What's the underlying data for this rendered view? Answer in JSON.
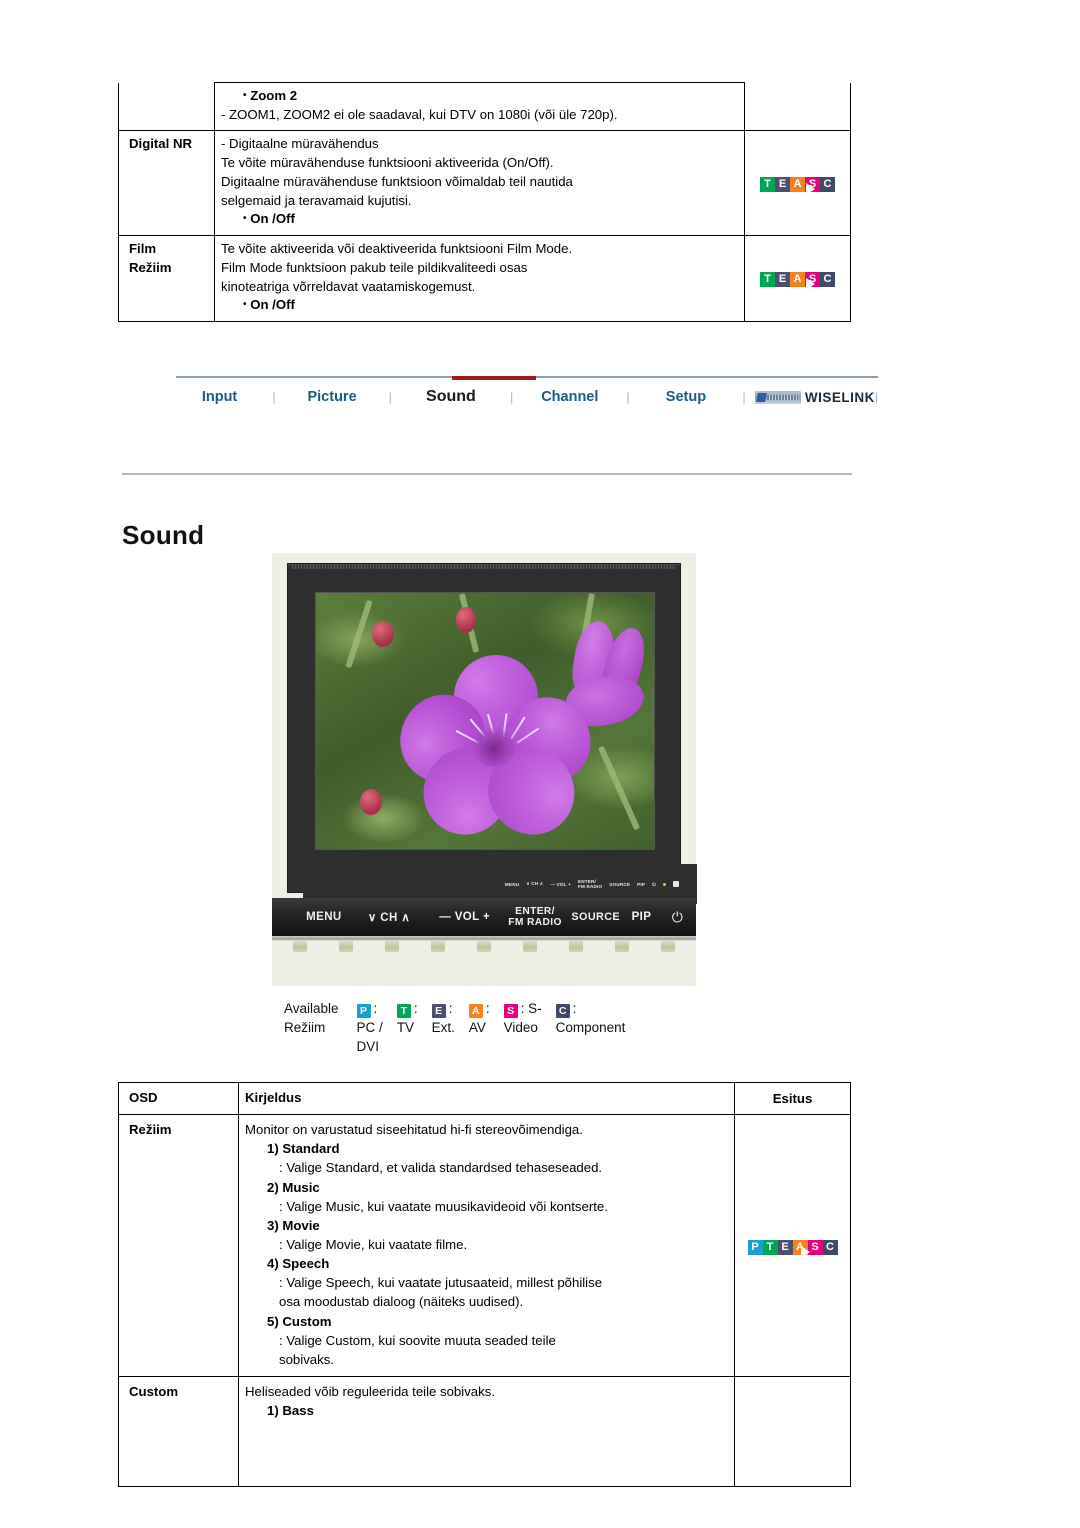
{
  "top_table": {
    "rows": [
      {
        "label": "",
        "bullet": "Zoom 2",
        "lines": [
          "- ZOOM1, ZOOM2 ei ole saadaval, kui DTV on 1080i (või üle 720p)."
        ],
        "footer": "",
        "icon": null
      },
      {
        "label": "Digital NR",
        "bullet": "",
        "lines": [
          "- Digitaalne müravähendus",
          "Te võite müravähenduse funktsiooni aktiveerida (On/Off).",
          "Digitaalne müravähenduse funktsioon võimaldab teil nautida",
          "selgemaid ja teravamaid kujutisi."
        ],
        "footer": "On /Off",
        "icon": {
          "name": "play-globe-icon",
          "badges": [
            "T",
            "E",
            "A",
            "S",
            "C"
          ]
        }
      },
      {
        "label_line1": "Film",
        "label_line2": "Režiim",
        "bullet": "",
        "lines": [
          "Te võite aktiveerida või deaktiveerida funktsiooni Film Mode.",
          "Film Mode funktsioon pakub teile pildikvaliteedi osas",
          "kinoteatriga võrreldavat vaatamiskogemust."
        ],
        "footer": "On /Off",
        "icon": {
          "name": "play-globe-icon",
          "badges": [
            "T",
            "E",
            "A",
            "S",
            "C"
          ]
        }
      }
    ]
  },
  "nav": {
    "tabs": [
      {
        "label": "Input",
        "active": false
      },
      {
        "label": "Picture",
        "active": false
      },
      {
        "label": "Sound",
        "active": true
      },
      {
        "label": "Channel",
        "active": false
      },
      {
        "label": "Setup",
        "active": false
      }
    ],
    "separator": "|",
    "wiselink_label": "WISELINK",
    "wiselink_logo": "wiselink-logo-icon",
    "active_color": "#9e1b1b",
    "tab_color": "#1d5c7c"
  },
  "page_title": "Sound",
  "monitor": {
    "screen_content": "purple tibouchina flower photo on green foliage",
    "control_buttons": {
      "menu": "MENU",
      "ch_down": "∨",
      "ch": "CH",
      "ch_up": "∧",
      "vol_minus": "—",
      "vol": "VOL",
      "vol_plus": "+",
      "enter_line1": "ENTER/",
      "enter_line2": "FM RADIO",
      "source": "SOURCE",
      "pip": "PIP",
      "power": "⏻"
    }
  },
  "available_modes": {
    "label_line1": "Available",
    "label_line2": "Režiim",
    "items": [
      {
        "badge": "P",
        "color": "#1a9ed4",
        "colon": ":",
        "name_line1": "PC /",
        "name_line2": "DVI"
      },
      {
        "badge": "T",
        "color": "#00a651",
        "colon": ":",
        "name_line1": "TV",
        "name_line2": ""
      },
      {
        "badge": "E",
        "color": "#4d4f6e",
        "colon": ":",
        "name_line1": "Ext.",
        "name_line2": ""
      },
      {
        "badge": "A",
        "color": "#f58220",
        "colon": ":",
        "name_line1": "AV",
        "name_line2": ""
      },
      {
        "badge": "S",
        "color": "#e5007d",
        "colon": ": S-",
        "name_line1": "Video",
        "name_line2": ""
      },
      {
        "badge": "C",
        "color": "#3f4a63",
        "colon": ":",
        "name_line1": "Component",
        "name_line2": ""
      }
    ]
  },
  "bottom_table": {
    "headers": {
      "osd": "OSD",
      "kirjeldus": "Kirjeldus",
      "esitus": "Esitus"
    },
    "rows": [
      {
        "osd": "Režiim",
        "intro": "Monitor on varustatud siseehitatud hi-fi stereovõimendiga.",
        "items": [
          {
            "num": "1) Standard",
            "desc": ": Valige Standard, et valida standardsed tehaseseaded."
          },
          {
            "num": "2) Music",
            "desc": ": Valige Music, kui vaatate muusikavideoid või kontserte."
          },
          {
            "num": "3) Movie",
            "desc": ": Valige Movie, kui vaatate filme."
          },
          {
            "num": "4) Speech",
            "desc": ": Valige Speech, kui vaatate jutusaateid, millest põhilise",
            "desc2": "osa moodustab dialoog (näiteks uudised)."
          },
          {
            "num": "5) Custom",
            "desc": ": Valige Custom, kui soovite muuta seaded teile",
            "desc2": "sobivaks."
          }
        ],
        "icon": {
          "name": "play-globe-icon",
          "badges": [
            "P",
            "T",
            "E",
            "A",
            "S",
            "C"
          ]
        }
      },
      {
        "osd": "Custom",
        "intro": "Heliseaded võib reguleerida teile sobivaks.",
        "items": [
          {
            "num": "1) Bass",
            "desc": ""
          }
        ],
        "icon": null
      }
    ]
  },
  "badge_colors": {
    "P": "#1a9ed4",
    "T": "#00a651",
    "E": "#4d4f6e",
    "A": "#f58220",
    "S": "#e5007d",
    "C": "#3f4a63"
  }
}
